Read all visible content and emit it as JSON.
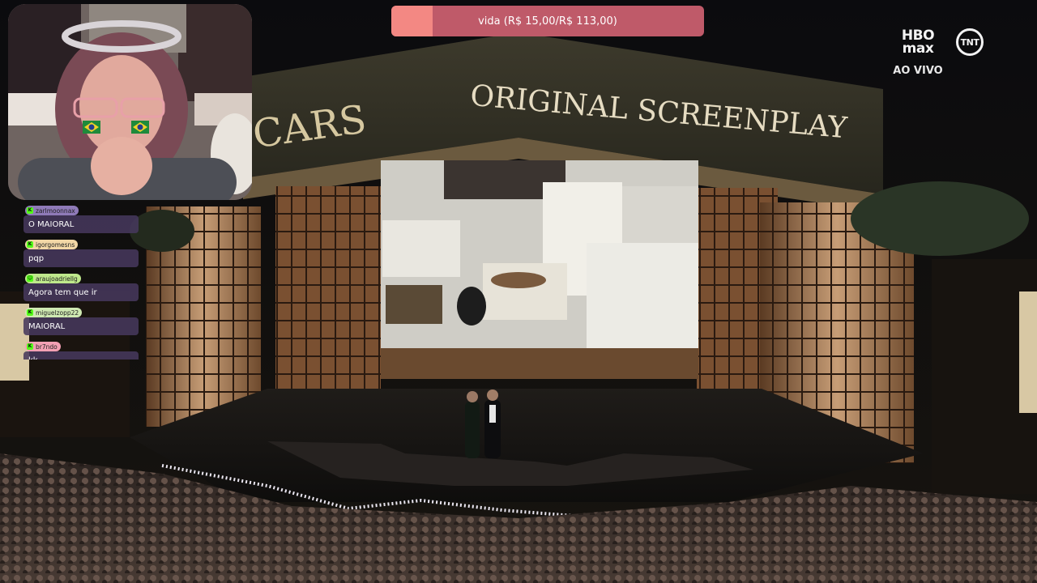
{
  "goal": {
    "label": "vida (R$ 15,00/R$ 113,00)",
    "raised": 15,
    "target": 113
  },
  "logos": {
    "hbo_line1": "HBO",
    "hbo_line2": "max",
    "tnt": "TNT",
    "live_label": "AO VIVO"
  },
  "stage": {
    "banner_text": "ORIGINAL SCREENPLAY",
    "side_text": "SCARS"
  },
  "chat": {
    "messages": [
      {
        "user": "zarlmoonnax",
        "text": "O MAIORAL",
        "name_bg": "#8f7ab8"
      },
      {
        "user": "igorgomesns",
        "text": "pqp",
        "name_bg": "#f2d7a6"
      },
      {
        "user": "araujoadriellg",
        "text": "Agora tem que ir",
        "name_bg": "#bfe88c"
      },
      {
        "user": "miguelzopp22",
        "text": "MAIORAL",
        "name_bg": "#cfe9b2"
      },
      {
        "user": "br7ndo",
        "text": "kk",
        "name_bg": "#f3a0b4"
      }
    ]
  },
  "colors": {
    "goal_fill": "#f38883",
    "goal_track": "#bf5a69",
    "chat_bubble": "#46385c",
    "kick_green": "#53fc18"
  }
}
